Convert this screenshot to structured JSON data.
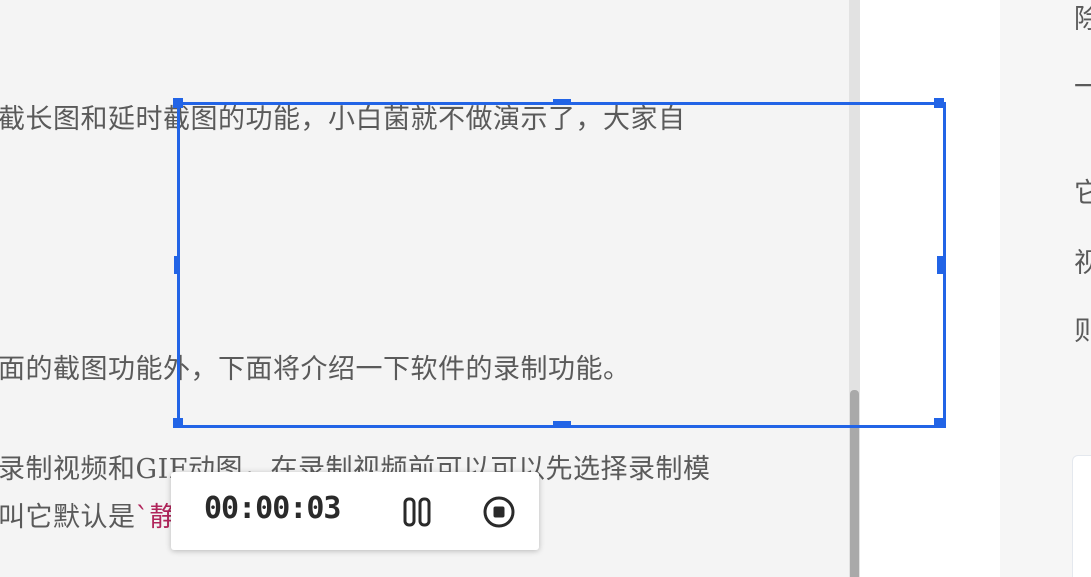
{
  "article": {
    "line1": "截长图和延时截图的功能，小白菌就不做演示了，大家自",
    "line2": "面的截图功能外，下面将介绍一下软件的录制功能。",
    "line3": "录制视频和GIF动图，在录制视频前可以可以先选择录制模",
    "line4_prefix": "叫它默认是",
    "line4_code": "`静"
  },
  "sidebar_fragments": [
    "除",
    "一",
    "它",
    "视",
    "则"
  ],
  "recorder": {
    "elapsed_time": "00:00:03",
    "pause_icon": "pause-icon",
    "stop_icon": "stop-record-icon"
  },
  "colors": {
    "selection": "#2264e6",
    "inline_code": "#b0245a",
    "body_text": "#5a5a5a"
  }
}
